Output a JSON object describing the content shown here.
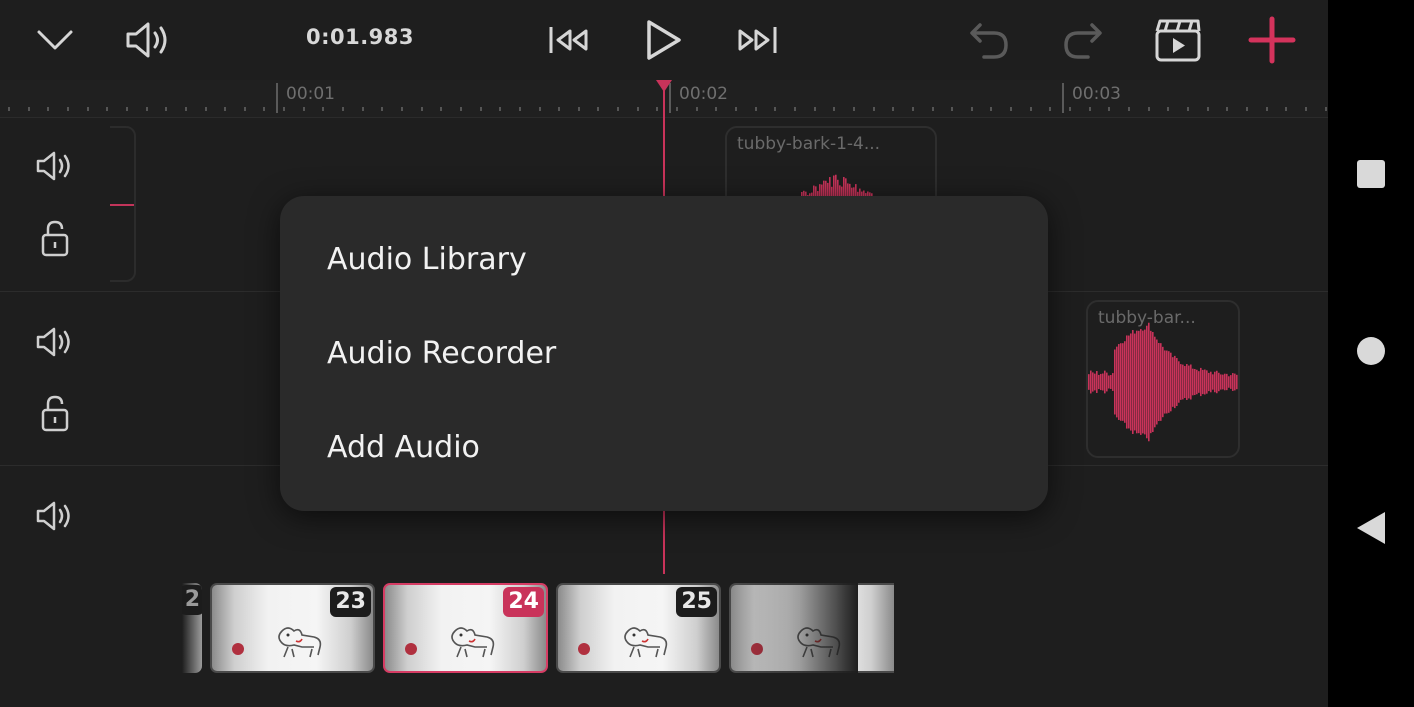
{
  "toolbar": {
    "timecode": "0:01.983",
    "icons": [
      "chevron-down-icon",
      "volume-icon",
      "skip-to-start-icon",
      "play-icon",
      "skip-to-end-icon",
      "undo-icon",
      "redo-icon",
      "clapperboard-icon",
      "plus-icon"
    ]
  },
  "ruler": {
    "labels": [
      "00:01",
      "00:02",
      "00:03"
    ]
  },
  "tracks": {
    "clip1_name": "tubby-bark-1-4...",
    "clip2_name": "tubby-bar..."
  },
  "filmstrip": {
    "partial_number": "2",
    "frames": [
      {
        "number": "23"
      },
      {
        "number": "24"
      },
      {
        "number": "25"
      },
      {
        "number": ""
      }
    ],
    "selected_frame": "24"
  },
  "menu": {
    "items": [
      "Audio Library",
      "Audio Recorder",
      "Add Audio"
    ]
  },
  "navbar": {
    "icons": [
      "recents-square-icon",
      "home-circle-icon",
      "back-triangle-icon"
    ]
  },
  "colors": {
    "accent": "#c9335a",
    "background": "#1e1e1e",
    "menu_background": "#2a2a2a"
  }
}
